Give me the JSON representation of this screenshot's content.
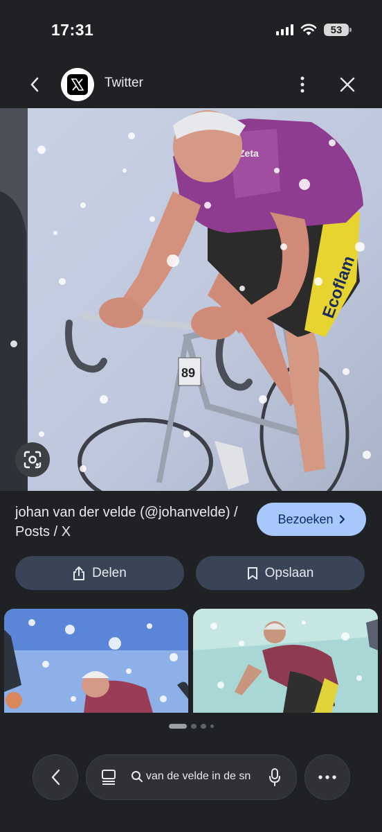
{
  "status_bar": {
    "time": "17:31",
    "battery": "53"
  },
  "header": {
    "site_name": "Twitter",
    "icons": [
      "back-arrow-icon",
      "x-logo-icon",
      "more-vertical-icon",
      "close-icon"
    ]
  },
  "result": {
    "title": "johan van der velde (@johanvelde) / Posts / X",
    "visit_label": "Bezoeken",
    "share_label": "Delen",
    "save_label": "Opslaan",
    "image_content_text": [
      "Zeta",
      "Ecoflam",
      "89"
    ]
  },
  "pager": {
    "active_index": 0,
    "count": 4
  },
  "bottom_bar": {
    "search_query": "van de velde in de sn"
  },
  "colors": {
    "background": "#202124",
    "visit_button": "#a8c7fa",
    "pill_button": "#394457",
    "jersey": "#8e3c8f",
    "shorts_yellow": "#e8d430"
  }
}
